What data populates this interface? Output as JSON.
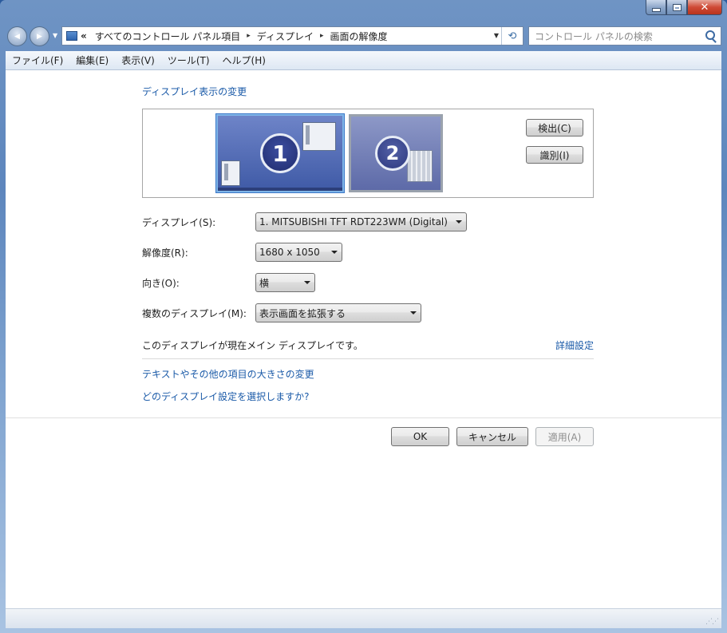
{
  "window": {
    "close_glyph": "✕"
  },
  "nav": {
    "back_glyph": "◀",
    "forward_glyph": "▶",
    "address": {
      "prefix": "«",
      "crumbs": [
        "すべてのコントロール パネル項目",
        "ディスプレイ",
        "画面の解像度"
      ],
      "separator": "▸",
      "refresh_glyph": "⟲"
    },
    "search": {
      "placeholder": "コントロール パネルの検索"
    }
  },
  "menu": [
    "ファイル(F)",
    "編集(E)",
    "表示(V)",
    "ツール(T)",
    "ヘルプ(H)"
  ],
  "main": {
    "heading": "ディスプレイ表示の変更",
    "monitors": [
      {
        "number": "1",
        "selected": true
      },
      {
        "number": "2",
        "selected": false
      }
    ],
    "detect_button": "検出(C)",
    "identify_button": "識別(I)",
    "display_label": "ディスプレイ(S):",
    "display_value": "1. MITSUBISHI TFT RDT223WM (Digital)",
    "resolution_label": "解像度(R):",
    "resolution_value": "1680 x 1050",
    "orientation_label": "向き(O):",
    "orientation_value": "横",
    "multi_label": "複数のディスプレイ(M):",
    "multi_value": "表示画面を拡張する",
    "info_text": "このディスプレイが現在メイン ディスプレイです。",
    "advanced_link": "詳細設定",
    "link_text_size": "テキストやその他の項目の大きさの変更",
    "link_which_setting": "どのディスプレイ設定を選択しますか?"
  },
  "buttons": {
    "ok": "OK",
    "cancel": "キャンセル",
    "apply": "適用(A)"
  },
  "status": {
    "grip": "⋰⋰"
  },
  "colors": {
    "link": "#1a5aa8",
    "selected_monitor_border": "#7fb5e8",
    "frame": "#5d86bd"
  }
}
